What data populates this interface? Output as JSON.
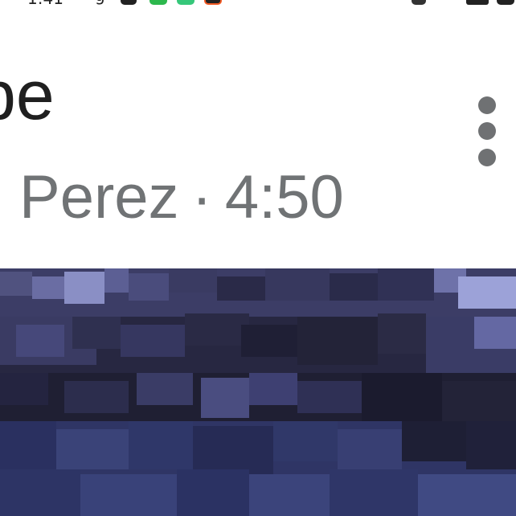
{
  "status_bar": {
    "time": "1:41",
    "app_letter": "g"
  },
  "video": {
    "title_fragment": "be",
    "channel_fragment": "Perez",
    "separator": "·",
    "duration_fragment": "4:50"
  },
  "more_options": {
    "icon": "more-vert-icon"
  },
  "thumbnail": {
    "description": "dark-blue pixelated scenery"
  }
}
